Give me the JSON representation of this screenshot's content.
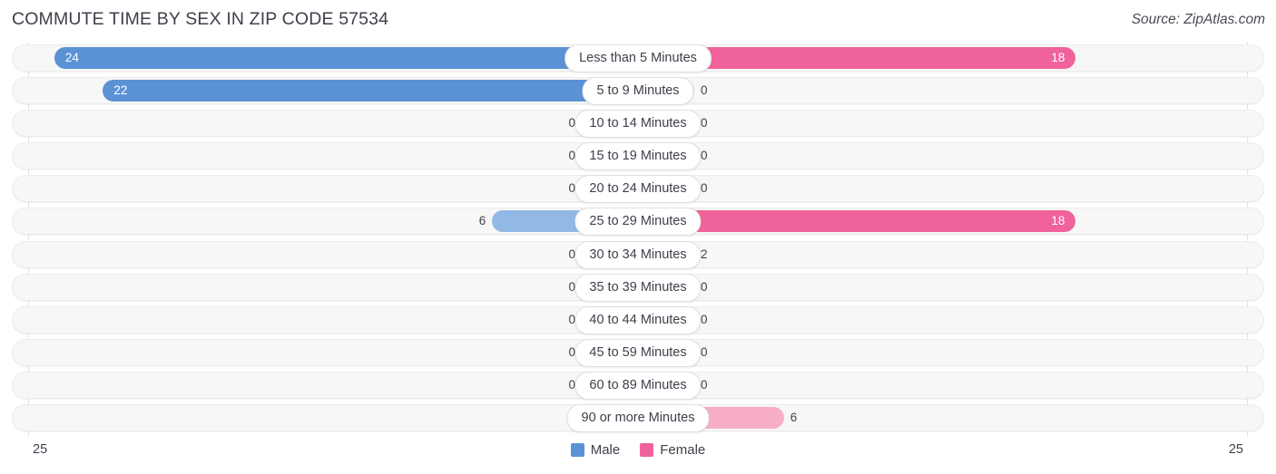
{
  "header": {
    "title": "COMMUTE TIME BY SEX IN ZIP CODE 57534",
    "source": "Source: ZipAtlas.com"
  },
  "legend": {
    "male_label": "Male",
    "female_label": "Female",
    "male_color": "#5b92d6",
    "female_color": "#f0629a",
    "male_color_low": "#92b9e6",
    "female_color_low": "#f8aec8"
  },
  "axis": {
    "left_tick": "25",
    "right_tick": "25"
  },
  "chart_data": {
    "type": "bar",
    "title": "COMMUTE TIME BY SEX IN ZIP CODE 57534",
    "subtitle": "Source: ZipAtlas.com",
    "orientation": "horizontal-diverging",
    "xlabel": "",
    "ylabel": "",
    "xlim": [
      25,
      25
    ],
    "axis_max": 25,
    "grid": false,
    "legend_position": "bottom-center",
    "categories": [
      "Less than 5 Minutes",
      "5 to 9 Minutes",
      "10 to 14 Minutes",
      "15 to 19 Minutes",
      "20 to 24 Minutes",
      "25 to 29 Minutes",
      "30 to 34 Minutes",
      "35 to 39 Minutes",
      "40 to 44 Minutes",
      "45 to 59 Minutes",
      "60 to 89 Minutes",
      "90 or more Minutes"
    ],
    "series": [
      {
        "name": "Male",
        "side": "left",
        "color": "#5b92d6",
        "values": [
          24,
          22,
          0,
          0,
          0,
          6,
          0,
          0,
          0,
          0,
          0,
          0
        ]
      },
      {
        "name": "Female",
        "side": "right",
        "color": "#f0629a",
        "values": [
          18,
          0,
          0,
          0,
          0,
          18,
          2,
          0,
          0,
          0,
          0,
          6
        ]
      }
    ],
    "rows": [
      {
        "category": "Less than 5 Minutes",
        "male": 24,
        "female": 18
      },
      {
        "category": "5 to 9 Minutes",
        "male": 22,
        "female": 0
      },
      {
        "category": "10 to 14 Minutes",
        "male": 0,
        "female": 0
      },
      {
        "category": "15 to 19 Minutes",
        "male": 0,
        "female": 0
      },
      {
        "category": "20 to 24 Minutes",
        "male": 0,
        "female": 0
      },
      {
        "category": "25 to 29 Minutes",
        "male": 6,
        "female": 18
      },
      {
        "category": "30 to 34 Minutes",
        "male": 0,
        "female": 2
      },
      {
        "category": "35 to 39 Minutes",
        "male": 0,
        "female": 0
      },
      {
        "category": "40 to 44 Minutes",
        "male": 0,
        "female": 0
      },
      {
        "category": "45 to 59 Minutes",
        "male": 0,
        "female": 0
      },
      {
        "category": "60 to 89 Minutes",
        "male": 0,
        "female": 0
      },
      {
        "category": "90 or more Minutes",
        "male": 0,
        "female": 6
      }
    ]
  }
}
